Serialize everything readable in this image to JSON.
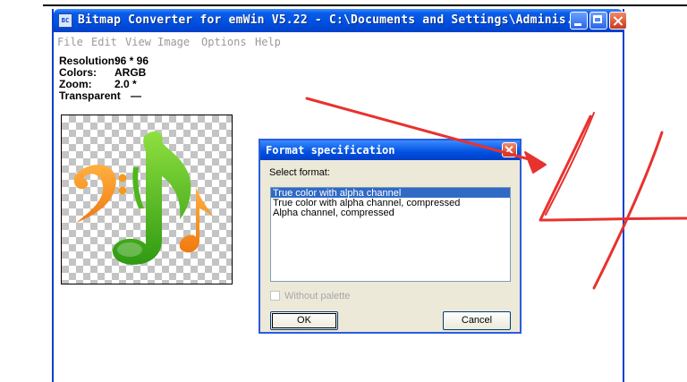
{
  "window": {
    "title": "Bitmap Converter for emWin V5.22 - C:\\Documents and Settings\\Adminis...",
    "icon_text": "BC"
  },
  "menu": [
    {
      "label": "File"
    },
    {
      "label": "Edit"
    },
    {
      "label": "View"
    },
    {
      "label": "Image"
    },
    {
      "label": "Options"
    },
    {
      "label": "Help"
    }
  ],
  "info": {
    "resolution_label": "Resolution:",
    "resolution_value": "96 * 96",
    "colors_label": "Colors:",
    "colors_value": "ARGB",
    "zoom_label": "Zoom:",
    "zoom_value": "2.0 *",
    "transparent_label": "Transparent",
    "transparent_value": "—"
  },
  "dialog": {
    "title": "Format specification",
    "select_label": "Select format:",
    "formats": [
      {
        "label": "True color with alpha channel",
        "selected": true
      },
      {
        "label": "True color with alpha channel, compressed",
        "selected": false
      },
      {
        "label": "Alpha channel, compressed",
        "selected": false
      }
    ],
    "checkbox_label": "Without palette",
    "checkbox_checked": false,
    "checkbox_enabled": false,
    "ok_label": "OK",
    "cancel_label": "Cancel"
  },
  "annotation": {
    "handwritten_text": "4",
    "color": "#e8322e"
  },
  "colors": {
    "xp_blue": "#0050e0",
    "dialog_face": "#ece9d8",
    "selection": "#316ac5",
    "close_red": "#c83a1a"
  }
}
